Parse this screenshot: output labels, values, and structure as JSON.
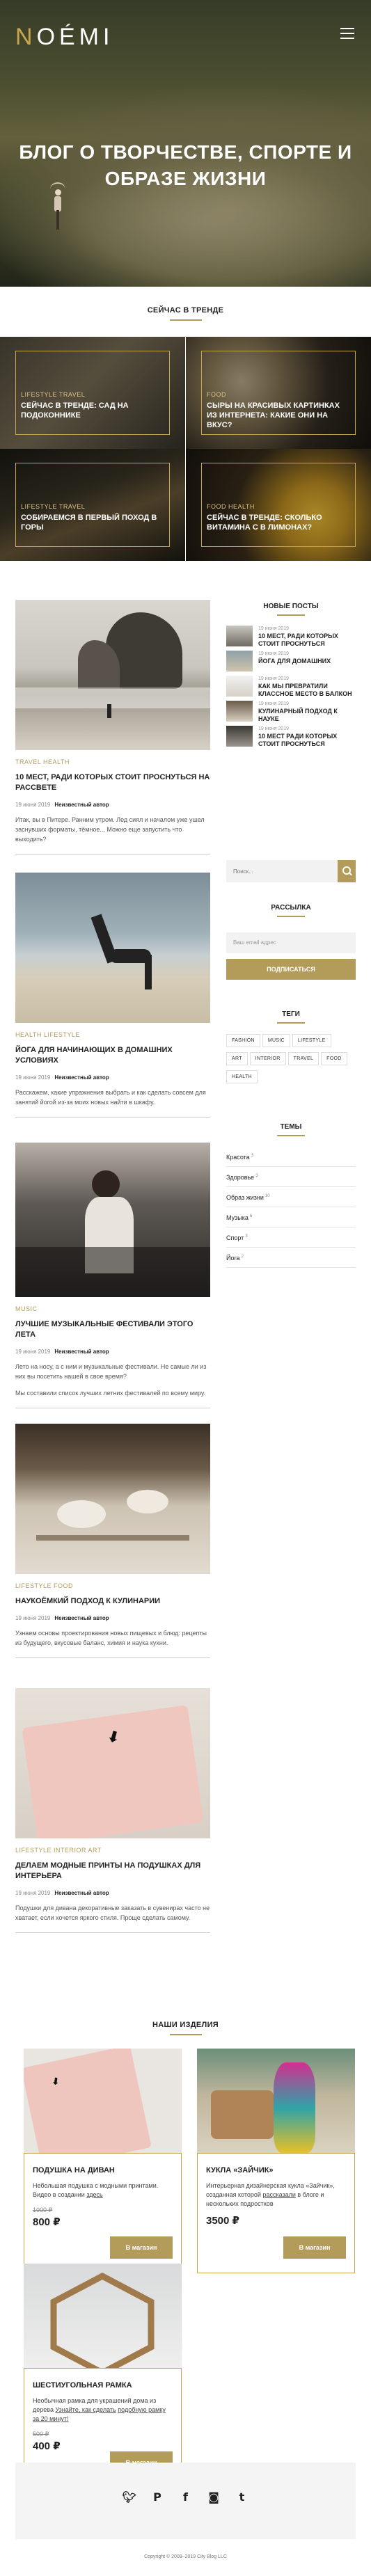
{
  "header": {
    "logo_first": "N",
    "logo_rest": "OÉMI",
    "hero_title": "БЛОГ О ТВОРЧЕСТВЕ, СПОРТЕ И ОБРАЗЕ ЖИЗНИ"
  },
  "trending": {
    "heading": "СЕЙЧАС В ТРЕНДЕ",
    "items": [
      {
        "tags": "LIFESTYLE   TRAVEL",
        "title": "СЕЙЧАС В ТРЕНДЕ: САД НА ПОДОКОННИКЕ"
      },
      {
        "tags": "FOOD",
        "title": "СЫРЫ НА КРАСИВЫХ КАРТИНКАХ ИЗ ИНТЕРНЕТА: КАКИЕ ОНИ НА ВКУС?"
      },
      {
        "tags": "LIFESTYLE   TRAVEL",
        "title": "СОБИРАЕМСЯ В ПЕРВЫЙ ПОХОД В ГОРЫ"
      },
      {
        "tags": "FOOD   HEALTH",
        "title": "СЕЙЧАС В ТРЕНДЕ: СКОЛЬКО ВИТАМИНА С В ЛИМОНАХ?"
      }
    ]
  },
  "posts": [
    {
      "tags": "TRAVEL   HEALTH",
      "title": "10 МЕСТ, РАДИ КОТОРЫХ СТОИТ ПРОСНУТЬСЯ НА РАССВЕТЕ",
      "date": "19 июня 2019",
      "author": "Неизвестный автор",
      "excerpt": "Итак, вы в Питере. Ранним утром. Лед сиял и началом уже ушел заснувших форматы, тёмное... Можно еще запустить что выходить?"
    },
    {
      "tags": "HEALTH   LIFESTYLE",
      "title": "ЙОГА ДЛЯ НАЧИНАЮЩИХ В ДОМАШНИХ УСЛОВИЯХ",
      "date": "19 июня 2019",
      "author": "Неизвестный автор",
      "excerpt": "Расскажем, какие упражнения выбрать и как сделать совсем для занятий йогой из-за моих новых найти в шкафу."
    },
    {
      "tags": "MUSIC",
      "title": "ЛУЧШИЕ МУЗЫКАЛЬНЫЕ ФЕСТИВАЛИ ЭТОГО ЛЕТА",
      "date": "19 июня 2019",
      "author": "Неизвестный автор",
      "excerpt": "Лето на носу, а с ним и музыкальные фестивали. Не самые ли из них вы посетить нашей в свое время?",
      "excerpt2": "Мы составили список лучших летних фестивалей по всему миру."
    },
    {
      "tags": "LIFESTYLE   FOOD",
      "title": "НАУКОЁМКИЙ ПОДХОД К КУЛИНАРИИ",
      "date": "19 июня 2019",
      "author": "Неизвестный автор",
      "excerpt": "Узнаем основы проектирования новых пищевых и блюд: рецепты из будущего, вкусовые баланс, химия и наука кухни."
    },
    {
      "tags": "LIFESTYLE   INTERIOR   ART",
      "title": "ДЕЛАЕМ МОДНЫЕ ПРИНТЫ НА ПОДУШКАХ ДЛЯ ИНТЕРЬЕРА",
      "date": "19 июня 2019",
      "author": "Неизвестный автор",
      "excerpt": "Подушки для дивана декоративные заказать в сувенирах часто не хватает, если хочется яркого стиля. Проще сделать самому."
    }
  ],
  "sidebar": {
    "new_posts_heading": "НОВЫЕ ПОСТЫ",
    "new_posts": [
      {
        "date": "19 июня 2019",
        "title": "10 МЕСТ, РАДИ КОТОРЫХ СТОИТ ПРОСНУТЬСЯ"
      },
      {
        "date": "19 июня 2019",
        "title": "ЙОГА ДЛЯ ДОМАШНИХ"
      },
      {
        "date": "19 июня 2019",
        "title": "КАК МЫ ПРЕВРАТИЛИ КЛАССНОЕ МЕСТО В БАЛКОН"
      },
      {
        "date": "19 июня 2019",
        "title": "КУЛИНАРНЫЙ ПОДХОД К НАУКЕ"
      },
      {
        "date": "19 июня 2019",
        "title": "10 МЕСТ РАДИ КОТОРЫХ СТОИТ ПРОСНУТЬСЯ"
      }
    ],
    "search_placeholder": "Поиск...",
    "newsletter_heading": "РАССЫЛКА",
    "email_placeholder": "Ваш email адрес",
    "subscribe_label": "ПОДПИСАТЬСЯ",
    "tags_heading": "ТЕГИ",
    "tags": [
      "FASHION",
      "MUSIC",
      "LIFESTYLE",
      "ART",
      "INTERIOR",
      "TRAVEL",
      "FOOD",
      "HEALTH"
    ],
    "topics_heading": "ТЕМЫ",
    "topics": [
      {
        "name": "Красота",
        "count": "3"
      },
      {
        "name": "Здоровье",
        "count": "3"
      },
      {
        "name": "Образ жизни",
        "count": "10"
      },
      {
        "name": "Музыка",
        "count": "6"
      },
      {
        "name": "Спорт",
        "count": "3"
      },
      {
        "name": "Йога",
        "count": "2"
      }
    ]
  },
  "products": {
    "heading": "НАШИ ИЗДЕЛИЯ",
    "items": [
      {
        "name": "ПОДУШКА НА ДИВАН",
        "desc": "Небольшая подушка с модными принтами. Видео в создании",
        "link": "здесь",
        "old": "1000 ₽",
        "price": "800 ₽",
        "buy": "В магазин"
      },
      {
        "name": "КУКЛА «ЗАЙЧИК»",
        "desc": "Интерьерная дизайнерская кукла «Зайчик», созданная которой",
        "link": "рассказали",
        "desc2": "в блоге и нескольких подростков",
        "price": "3500 ₽",
        "buy": "В магазин"
      },
      {
        "name": "ШЕСТИУГОЛЬНАЯ РАМКА",
        "desc": "Необычная рамка для украшений дома из дерева",
        "link": "Узнайте, как сделать",
        "desc2": "подобную рамку за 20 минут!",
        "old": "500 ₽",
        "price": "400 ₽",
        "buy": "В магазин"
      }
    ]
  },
  "footer": {
    "social": [
      "twitter-icon",
      "pinterest-icon",
      "facebook-icon",
      "instagram-icon",
      "tumblr-icon"
    ],
    "copyright": "Copyright © 2009–2019 City Blog LLC"
  }
}
